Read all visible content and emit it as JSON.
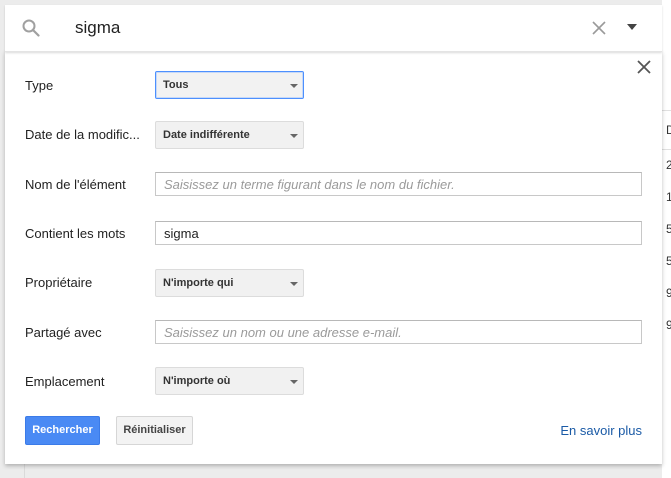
{
  "search": {
    "query": "sigma"
  },
  "background": {
    "header_letter": "D",
    "column_digits": [
      "2",
      "1",
      "5",
      "5",
      "9",
      "9"
    ]
  },
  "panel": {
    "rows": {
      "type": {
        "label": "Type",
        "value": "Tous"
      },
      "date": {
        "label": "Date de la modific...",
        "value": "Date indifférente"
      },
      "item_name": {
        "label": "Nom de l'élément",
        "placeholder": "Saisissez un terme figurant dans le nom du fichier.",
        "value": ""
      },
      "contains": {
        "label": "Contient les mots",
        "value": "sigma"
      },
      "owner": {
        "label": "Propriétaire",
        "value": "N'importe qui"
      },
      "shared": {
        "label": "Partagé avec",
        "placeholder": "Saisissez un nom ou une adresse e-mail.",
        "value": ""
      },
      "location": {
        "label": "Emplacement",
        "value": "N'importe où"
      }
    },
    "buttons": {
      "search": "Rechercher",
      "reset": "Réinitialiser",
      "learn_more": "En savoir plus"
    }
  },
  "icons": {
    "search": "search-icon",
    "clear": "close-icon",
    "dropdown": "caret-down-icon",
    "panel_close": "close-icon"
  },
  "colors": {
    "primary_button": "#4a8af4",
    "link": "#1a5aa6",
    "active_border": "#4d90fe"
  }
}
